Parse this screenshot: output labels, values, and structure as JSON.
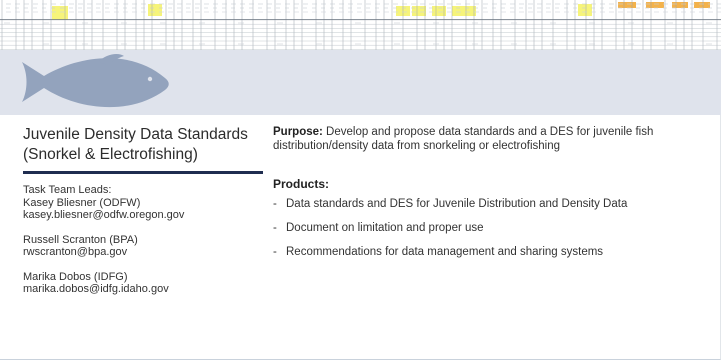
{
  "slide": {
    "title_line1": "Juvenile Density Data Standards",
    "title_line2": "(Snorkel & Electrofishing)",
    "leads_heading": "Task Team Leads:",
    "leads": [
      {
        "name": "Kasey Bliesner (ODFW)",
        "email": "kasey.bliesner@odfw.oregon.gov"
      },
      {
        "name": "Russell Scranton (BPA)",
        "email": "rwscranton@bpa.gov"
      },
      {
        "name": "Marika Dobos (IDFG)",
        "email": "marika.dobos@idfg.idaho.gov"
      }
    ],
    "purpose_label": "Purpose:",
    "purpose_text": " Develop and propose data standards and a DES for juvenile fish distribution/density data from snorkeling or electrofishing",
    "products_heading": "Products:",
    "bullet": "-",
    "products": [
      "Data standards and DES for Juvenile Distribution and Density Data",
      "Document on limitation and proper use",
      "Recommendations for data management and sharing systems"
    ]
  },
  "colors": {
    "band": "#dfe3ec",
    "fish": "#93a3bd",
    "rule": "#1f2d50",
    "header_yellow": "#f6f47a",
    "header_orange": "#f3b24b"
  },
  "icons": {
    "fish": "fish-icon",
    "spreadsheet": "spreadsheet-banner"
  }
}
